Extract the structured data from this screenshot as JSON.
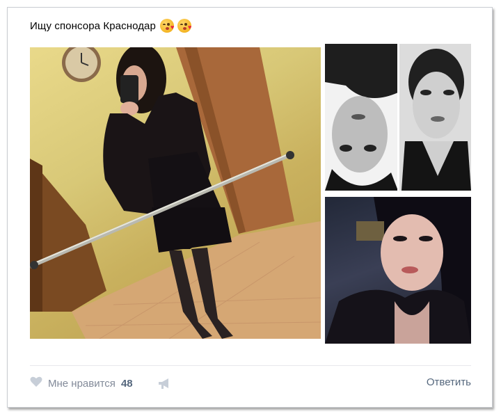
{
  "post": {
    "text": "Ищу спонсора Краснодар",
    "emoji_1": "kissing-face-with-heart-emoji",
    "emoji_2": "kissing-face-with-heart-emoji"
  },
  "photos": [
    {
      "name": "mirror-selfie-photo"
    },
    {
      "name": "upside-down-bw-selfie-photo"
    },
    {
      "name": "dark-selfie-photo"
    }
  ],
  "actions": {
    "like_label": "Мне нравится",
    "like_count": "48",
    "share_icon": "megaphone-icon",
    "reply_label": "Ответить"
  },
  "colors": {
    "link": "#55677d",
    "muted": "#828a99",
    "divider": "#e7e8ec"
  }
}
